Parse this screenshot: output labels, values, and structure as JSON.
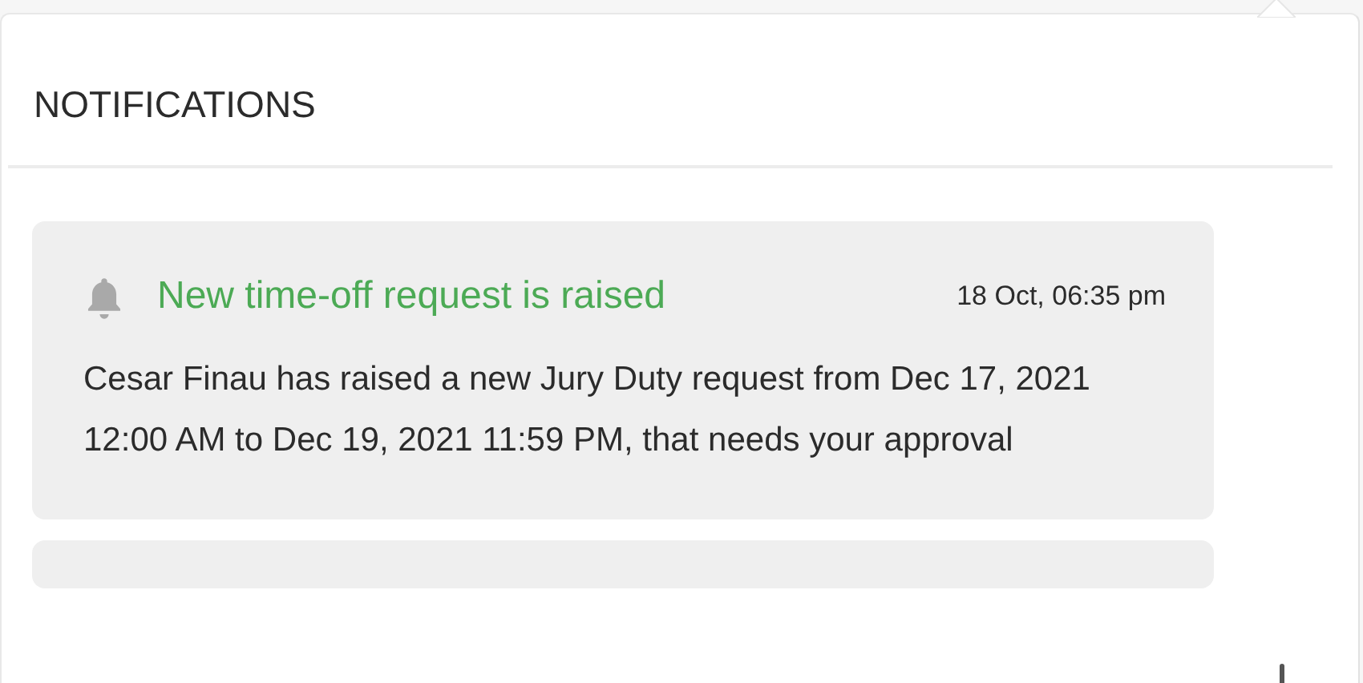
{
  "panel": {
    "title": "NOTIFICATIONS"
  },
  "notifications": [
    {
      "kind": "bell",
      "title": "New time-off request is raised",
      "time": "18 Oct, 06:35 pm",
      "message": "Cesar Finau has raised a new Jury Duty request from Dec 17, 2021 12:00 AM to Dec 19, 2021 11:59 PM, that needs your approval"
    },
    {
      "kind": "placeholder"
    }
  ]
}
